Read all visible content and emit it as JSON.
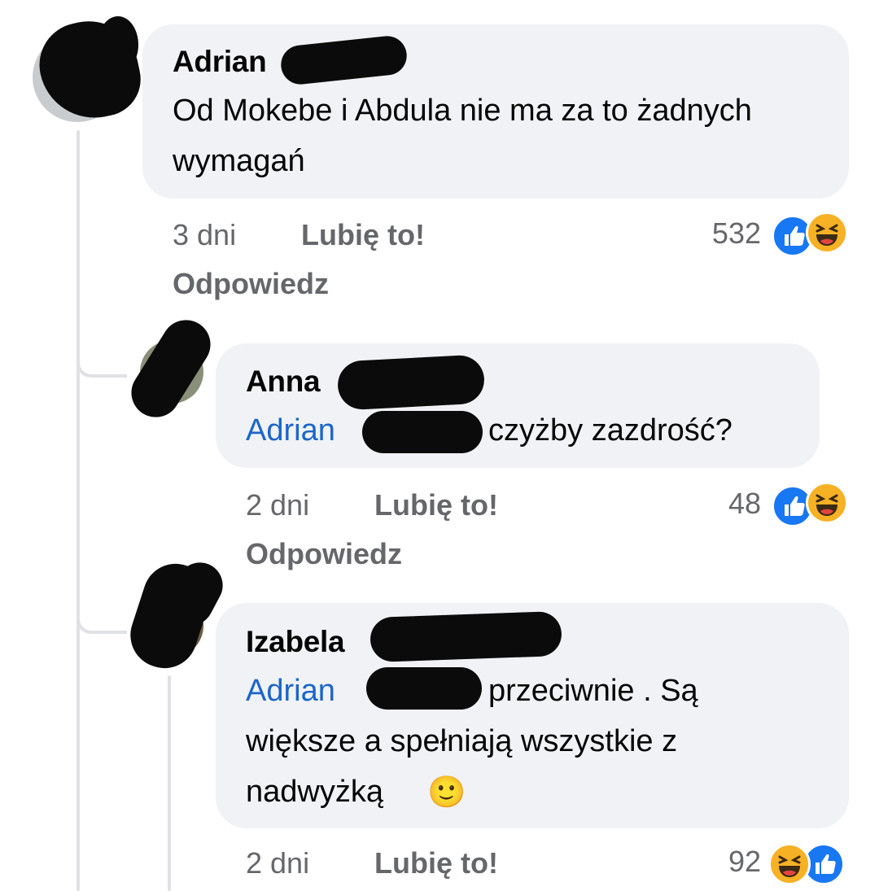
{
  "comments": [
    {
      "author": "Adrian",
      "text": "Od Mokebe i Abdula nie ma za to żadnych wymagań",
      "time": "3 dni",
      "like_label": "Lubię to!",
      "reply_label": "Odpowiedz",
      "reaction_count": "532",
      "reactions": [
        "like",
        "haha"
      ]
    },
    {
      "author": "Anna",
      "mention": "Adrian",
      "text": "czyżby zazdrość?",
      "time": "2 dni",
      "like_label": "Lubię to!",
      "reply_label": "Odpowiedz",
      "reaction_count": "48",
      "reactions": [
        "like",
        "haha"
      ]
    },
    {
      "author": "Izabela",
      "mention": "Adrian",
      "text_line1": "przeciwnie . Są",
      "text_line2": "większe a spełniają wszystkie z",
      "text_line3": "nadwyżką",
      "emoji": "🙂",
      "time": "2 dni",
      "like_label": "Lubię to!",
      "reaction_count": "92",
      "reactions": [
        "haha",
        "like"
      ]
    }
  ],
  "colors": {
    "bubble": "#f0f2f5",
    "mention": "#1b66c9",
    "meta": "#65676b",
    "like": "#1877f2",
    "haha": "#f7b125"
  }
}
